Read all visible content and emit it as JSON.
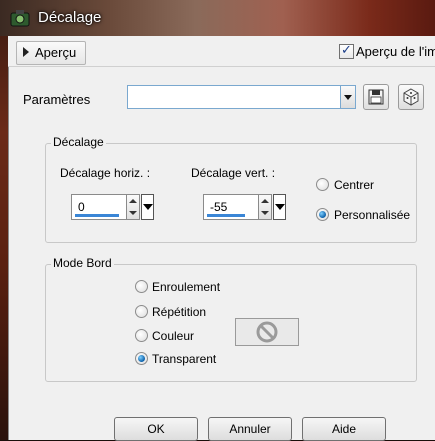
{
  "window": {
    "title": "Décalage"
  },
  "preview": {
    "label": "Aperçu",
    "checkbox_label": "Aperçu de l'im",
    "checked": true
  },
  "parameters": {
    "label": "Paramètres",
    "value": "",
    "save_icon": "save-icon",
    "random_icon": "dice-icon"
  },
  "offset_group": {
    "title": "Décalage",
    "horizontal_label": "Décalage horiz. :",
    "horizontal_value": "0",
    "vertical_label": "Décalage vert. :",
    "vertical_value": "-55",
    "options": [
      "Centrer",
      "Personnalisée"
    ],
    "selected": "Personnalisée"
  },
  "edge_group": {
    "title": "Mode Bord",
    "options": [
      "Enroulement",
      "Répétition",
      "Couleur",
      "Transparent"
    ],
    "selected": "Transparent",
    "color_icon": "no-color-icon"
  },
  "buttons": {
    "ok": "OK",
    "cancel": "Annuler",
    "help": "Aide"
  },
  "colors": {
    "accent": "#3a86d6",
    "radio_selected": "#0b5fa8",
    "window_bg": "#f0f0f0"
  }
}
